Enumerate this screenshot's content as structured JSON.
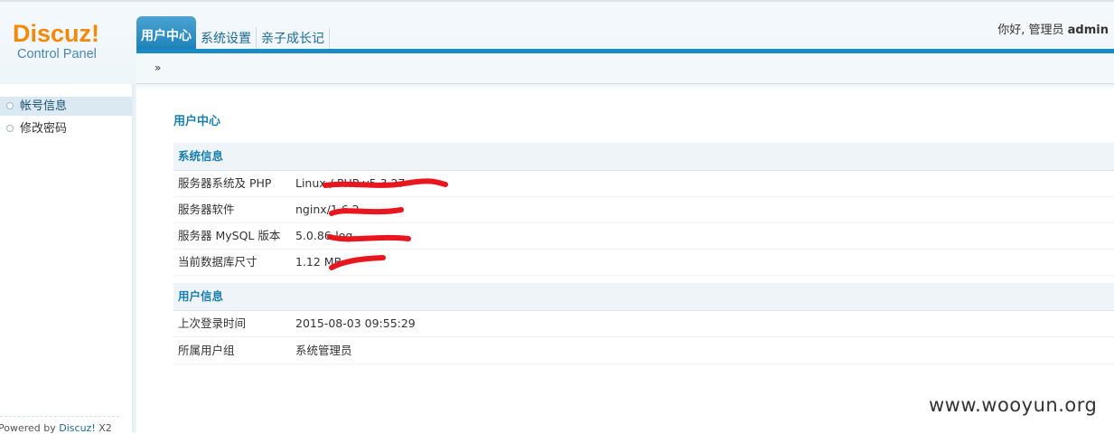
{
  "brand": {
    "name": "Discuz",
    "bang": "!",
    "subtitle": "Control Panel"
  },
  "nav": {
    "tabs": [
      {
        "label": "用户中心",
        "active": true
      },
      {
        "label": "系统设置",
        "active": false
      },
      {
        "label": "亲子成长记",
        "active": false
      }
    ]
  },
  "user_info": {
    "greeting": "你好, 管理员",
    "username": "admin"
  },
  "breadcrumb": {
    "separator": "»"
  },
  "sidebar": {
    "items": [
      {
        "label": "帐号信息",
        "active": true
      },
      {
        "label": "修改密码",
        "active": false
      }
    ],
    "footer": {
      "prefix": "Powered by",
      "link": "Discuz!",
      "suffix": "X2"
    }
  },
  "main": {
    "title": "用户中心",
    "system_section": {
      "heading": "系统信息",
      "rows": [
        {
          "label": "服务器系统及 PHP",
          "value": "Linux / PHP v5.3.27",
          "redacted": true
        },
        {
          "label": "服务器软件",
          "value": "nginx/1.6.2",
          "redacted": true
        },
        {
          "label": "服务器 MySQL 版本",
          "value": "5.0.86-log",
          "redacted": true
        },
        {
          "label": "当前数据库尺寸",
          "value": "1.12 MB",
          "redacted": true
        }
      ]
    },
    "user_section": {
      "heading": "用户信息",
      "rows": [
        {
          "label": "上次登录时间",
          "value": "2015-08-03 09:55:29"
        },
        {
          "label": "所属用户组",
          "value": "系统管理员"
        }
      ]
    }
  },
  "watermark": "www.wooyun.org",
  "colors": {
    "accent": "#1a8ac4",
    "brand_orange": "#f08a0a",
    "redaction": "#e8161e"
  }
}
